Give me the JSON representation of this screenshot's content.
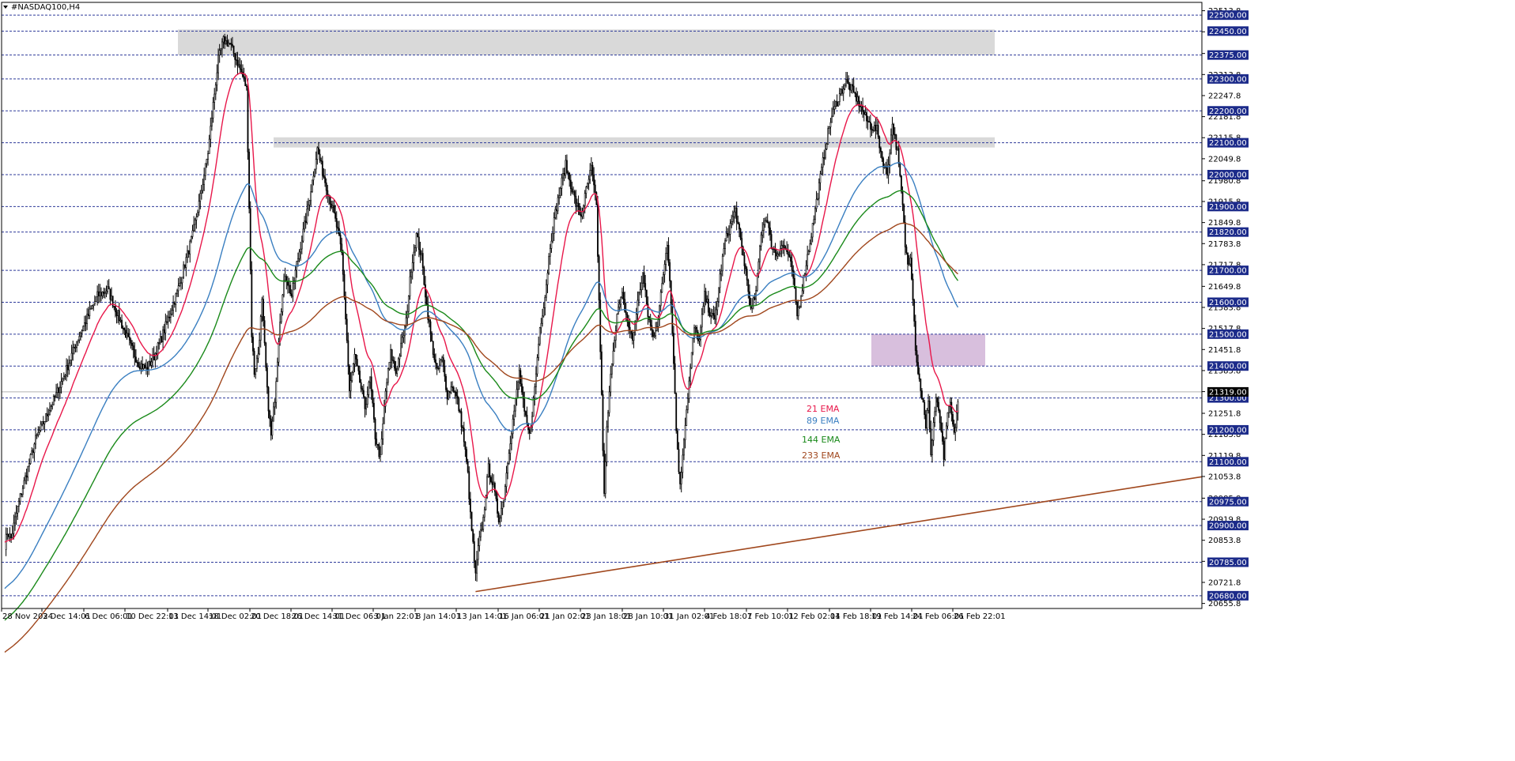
{
  "chart_data": {
    "type": "candlestick",
    "symbol": "#NASDAQ100,H4",
    "ylim": [
      20640,
      22540
    ],
    "x_tick_labels": [
      "28 Nov 2024",
      "3 Dec 14:01",
      "6 Dec 06:01",
      "10 Dec 22:01",
      "13 Dec 14:01",
      "18 Dec 02:01",
      "20 Dec 18:01",
      "26 Dec 14:01",
      "31 Dec 06:01",
      "3 Jan 22:01",
      "8 Jan 14:01",
      "13 Jan 14:01",
      "16 Jan 06:01",
      "21 Jan 02:01",
      "23 Jan 18:01",
      "28 Jan 10:01",
      "31 Jan 02:01",
      "4 Feb 18:01",
      "7 Feb 10:01",
      "12 Feb 02:01",
      "14 Feb 18:01",
      "19 Feb 14:01",
      "24 Feb 06:01",
      "26 Feb 22:01"
    ],
    "y_tick_labels": [
      22513.8,
      22447.8,
      22379.8,
      22313.8,
      22247.8,
      22181.8,
      22115.8,
      22049.8,
      21980.8,
      21915.8,
      21849.8,
      21783.8,
      21717.8,
      21649.8,
      21583.8,
      21517.8,
      21451.8,
      21385.8,
      21319.8,
      21251.8,
      21185.8,
      21119.8,
      21053.8,
      20985.8,
      20919.8,
      20853.8,
      20787.8,
      20721.8,
      20655.8
    ],
    "price_levels": [
      22500.0,
      22450.0,
      22375.0,
      22300.0,
      22200.0,
      22100.0,
      22000.0,
      21900.0,
      21820.0,
      21700.0,
      21600.0,
      21500.0,
      21400.0,
      21300.0,
      21200.0,
      21100.0,
      20975.0,
      20900.0,
      20785.0,
      20680.0
    ],
    "current_price": "21319.00",
    "ema_legend": [
      {
        "label": "21 EMA",
        "color": "#e8174a"
      },
      {
        "label": "89 EMA",
        "color": "#3a7fc1"
      },
      {
        "label": "144 EMA",
        "color": "#1a8a1a"
      },
      {
        "label": "233 EMA",
        "color": "#a0471d"
      }
    ],
    "zones": [
      {
        "from": 22375,
        "to": 22455,
        "color": "#d9d9d9"
      },
      {
        "from": 22085,
        "to": 22117,
        "color": "#d9d9d9"
      },
      {
        "from": 21400,
        "to": 21500,
        "color": "#d8bfdd"
      }
    ],
    "close_path": [
      [
        0,
        20840
      ],
      [
        2,
        20880
      ],
      [
        5,
        20860
      ],
      [
        8,
        20920
      ],
      [
        12,
        20990
      ],
      [
        18,
        21080
      ],
      [
        24,
        21170
      ],
      [
        32,
        21240
      ],
      [
        40,
        21310
      ],
      [
        48,
        21390
      ],
      [
        56,
        21480
      ],
      [
        64,
        21550
      ],
      [
        72,
        21620
      ],
      [
        80,
        21640
      ],
      [
        86,
        21580
      ],
      [
        92,
        21520
      ],
      [
        98,
        21460
      ],
      [
        104,
        21410
      ],
      [
        110,
        21390
      ],
      [
        116,
        21430
      ],
      [
        122,
        21490
      ],
      [
        128,
        21560
      ],
      [
        134,
        21630
      ],
      [
        140,
        21720
      ],
      [
        146,
        21810
      ],
      [
        152,
        21930
      ],
      [
        158,
        22070
      ],
      [
        162,
        22220
      ],
      [
        166,
        22360
      ],
      [
        170,
        22420
      ],
      [
        175,
        22410
      ],
      [
        180,
        22360
      ],
      [
        184,
        22320
      ],
      [
        188,
        22270
      ],
      [
        190,
        21900
      ],
      [
        192,
        21500
      ],
      [
        194,
        21380
      ],
      [
        197,
        21440
      ],
      [
        200,
        21600
      ],
      [
        204,
        21320
      ],
      [
        207,
        21180
      ],
      [
        210,
        21300
      ],
      [
        214,
        21550
      ],
      [
        218,
        21690
      ],
      [
        223,
        21620
      ],
      [
        227,
        21720
      ],
      [
        231,
        21800
      ],
      [
        235,
        21880
      ],
      [
        239,
        21980
      ],
      [
        243,
        22080
      ],
      [
        247,
        22010
      ],
      [
        251,
        21950
      ],
      [
        255,
        21890
      ],
      [
        259,
        21820
      ],
      [
        262,
        21750
      ],
      [
        264,
        21620
      ],
      [
        266,
        21480
      ],
      [
        268,
        21320
      ],
      [
        272,
        21430
      ],
      [
        276,
        21350
      ],
      [
        280,
        21270
      ],
      [
        284,
        21360
      ],
      [
        288,
        21180
      ],
      [
        292,
        21110
      ],
      [
        296,
        21320
      ],
      [
        300,
        21440
      ],
      [
        304,
        21380
      ],
      [
        308,
        21460
      ],
      [
        312,
        21540
      ],
      [
        316,
        21710
      ],
      [
        320,
        21810
      ],
      [
        324,
        21740
      ],
      [
        328,
        21590
      ],
      [
        332,
        21470
      ],
      [
        336,
        21380
      ],
      [
        340,
        21420
      ],
      [
        344,
        21310
      ],
      [
        348,
        21340
      ],
      [
        352,
        21290
      ],
      [
        356,
        21200
      ],
      [
        360,
        21060
      ],
      [
        362,
        20930
      ],
      [
        364,
        20840
      ],
      [
        366,
        20740
      ],
      [
        368,
        20830
      ],
      [
        372,
        20920
      ],
      [
        376,
        21080
      ],
      [
        380,
        21020
      ],
      [
        384,
        20920
      ],
      [
        388,
        20990
      ],
      [
        392,
        21140
      ],
      [
        396,
        21260
      ],
      [
        400,
        21380
      ],
      [
        404,
        21250
      ],
      [
        408,
        21180
      ],
      [
        412,
        21330
      ],
      [
        416,
        21520
      ],
      [
        420,
        21620
      ],
      [
        424,
        21780
      ],
      [
        428,
        21880
      ],
      [
        432,
        21960
      ],
      [
        436,
        22030
      ],
      [
        440,
        21970
      ],
      [
        444,
        21910
      ],
      [
        448,
        21870
      ],
      [
        452,
        21950
      ],
      [
        456,
        22020
      ],
      [
        460,
        21900
      ],
      [
        462,
        21600
      ],
      [
        464,
        21300
      ],
      [
        466,
        20990
      ],
      [
        468,
        21200
      ],
      [
        472,
        21420
      ],
      [
        476,
        21560
      ],
      [
        480,
        21620
      ],
      [
        484,
        21540
      ],
      [
        488,
        21480
      ],
      [
        492,
        21600
      ],
      [
        496,
        21690
      ],
      [
        500,
        21560
      ],
      [
        504,
        21490
      ],
      [
        508,
        21550
      ],
      [
        512,
        21690
      ],
      [
        515,
        21790
      ],
      [
        517,
        21680
      ],
      [
        520,
        21420
      ],
      [
        522,
        21200
      ],
      [
        525,
        21020
      ],
      [
        528,
        21180
      ],
      [
        532,
        21350
      ],
      [
        536,
        21520
      ],
      [
        540,
        21480
      ],
      [
        544,
        21620
      ],
      [
        548,
        21570
      ],
      [
        552,
        21540
      ],
      [
        556,
        21680
      ],
      [
        560,
        21790
      ],
      [
        564,
        21840
      ],
      [
        568,
        21890
      ],
      [
        572,
        21790
      ],
      [
        576,
        21700
      ],
      [
        580,
        21570
      ],
      [
        584,
        21630
      ],
      [
        588,
        21820
      ],
      [
        592,
        21870
      ],
      [
        596,
        21780
      ],
      [
        600,
        21750
      ],
      [
        604,
        21780
      ],
      [
        608,
        21760
      ],
      [
        612,
        21700
      ],
      [
        616,
        21560
      ],
      [
        618,
        21600
      ],
      [
        622,
        21700
      ],
      [
        626,
        21790
      ],
      [
        630,
        21890
      ],
      [
        634,
        21990
      ],
      [
        638,
        22090
      ],
      [
        642,
        22170
      ],
      [
        646,
        22220
      ],
      [
        650,
        22260
      ],
      [
        654,
        22290
      ],
      [
        658,
        22270
      ],
      [
        662,
        22240
      ],
      [
        666,
        22210
      ],
      [
        670,
        22170
      ],
      [
        674,
        22150
      ],
      [
        678,
        22140
      ],
      [
        682,
        22050
      ],
      [
        686,
        22000
      ],
      [
        690,
        22160
      ],
      [
        694,
        22070
      ],
      [
        698,
        21900
      ],
      [
        700,
        21780
      ],
      [
        702,
        21720
      ],
      [
        704,
        21750
      ],
      [
        706,
        21620
      ],
      [
        708,
        21460
      ],
      [
        710,
        21380
      ],
      [
        712,
        21330
      ],
      [
        714,
        21280
      ],
      [
        716,
        21200
      ],
      [
        718,
        21300
      ],
      [
        720,
        21120
      ],
      [
        722,
        21220
      ],
      [
        724,
        21300
      ],
      [
        728,
        21200
      ],
      [
        730,
        21100
      ],
      [
        732,
        21220
      ],
      [
        735,
        21280
      ],
      [
        738,
        21180
      ],
      [
        741,
        21290
      ]
    ]
  }
}
